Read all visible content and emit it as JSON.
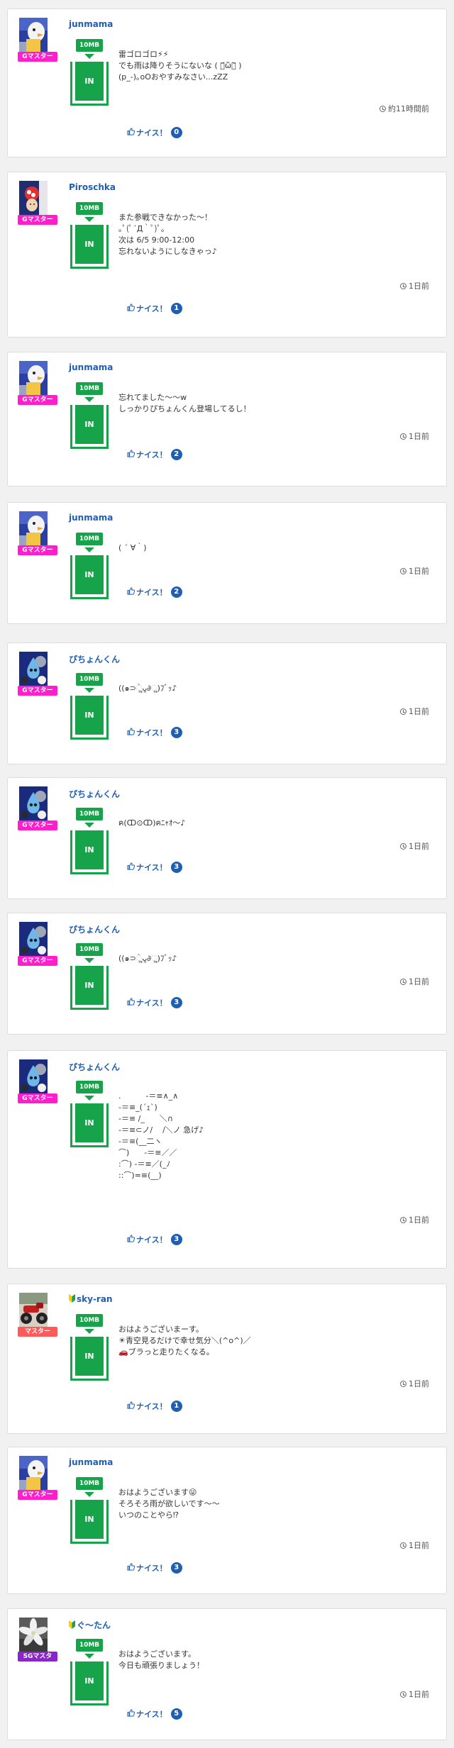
{
  "colors": {
    "username": "#1e5fb4",
    "green": "#16a34a",
    "rank_g_master": "#ff1dce",
    "rank_master": "#ff5a5a",
    "rank_sg_master": "#8a25c9",
    "nice_blue": "#1e5fb4"
  },
  "icons": {
    "time": "clock-icon",
    "nice": "thumbs-up-icon",
    "beginner": "beginner-leaf-icon"
  },
  "posts": [
    {
      "username": "junmama",
      "beginner": false,
      "rank": "Gマスター",
      "size_label": "10MB",
      "status_label": "IN",
      "message": "雷ゴロゴロ⚡⚡\nでも雨は降りそうにないな ( ･᷄ὢ･᷅ )\n(p_-)｡oOおやすみなさい...zZZ",
      "time": "約11時間前",
      "nice_label": "ナイス！",
      "nice_count": "0"
    },
    {
      "username": "Piroschka",
      "beginner": false,
      "rank": "Gマスター",
      "size_label": "10MB",
      "status_label": "IN",
      "message": "また参戦できなかった〜！\n｡ﾟ(ﾟ´Д｀ﾟ)ﾟ｡\n次は 6/5 9:00-12:00\n忘れないようにしなきゃっ♪",
      "time": "1日前",
      "nice_label": "ナイス！",
      "nice_count": "1"
    },
    {
      "username": "junmama",
      "beginner": false,
      "rank": "Gマスター",
      "size_label": "10MB",
      "status_label": "IN",
      "message": "忘れてました〜〜w\nしっかりぴちょんくん登場してるし！",
      "time": "1日前",
      "nice_label": "ナイス！",
      "nice_count": "2"
    },
    {
      "username": "junmama",
      "beginner": false,
      "rank": "Gマスター",
      "size_label": "10MB",
      "status_label": "IN",
      "message": "( ´ ∀｀)",
      "time": "1日前",
      "nice_label": "ナイス！",
      "nice_count": "2"
    },
    {
      "username": "ぴちょんくん",
      "beginner": false,
      "rank": "Gマスター",
      "size_label": "10MB",
      "status_label": "IN",
      "message": "((๑⊃ૢ̀ᴗ͈∂ૢ)ﾌﾞｯ♪",
      "time": "1日前",
      "nice_label": "ナイス！",
      "nice_count": "3"
    },
    {
      "username": "ぴちょんくん",
      "beginner": false,
      "rank": "Gマスター",
      "size_label": "10MB",
      "status_label": "IN",
      "message": "ฅ(ↀ⊙ↀ)ฅﾆｬｵ〜♪",
      "time": "1日前",
      "nice_label": "ナイス！",
      "nice_count": "3"
    },
    {
      "username": "ぴちょんくん",
      "beginner": false,
      "rank": "Gマスター",
      "size_label": "10MB",
      "status_label": "IN",
      "message": "((๑⊃ૢ̀ᴗ͈∂ૢ)ﾌﾞｯ♪",
      "time": "1日前",
      "nice_label": "ナイス！",
      "nice_count": "3"
    },
    {
      "username": "ぴちょんくん",
      "beginner": false,
      "rank": "Gマスター",
      "size_label": "10MB",
      "status_label": "IN",
      "message": ".          -＝≡∧_∧\n-＝≡_(´ｪ`)\n-＝≡ /_      ＼∩\n-＝≡⊂ノ/    /＼ノ 急げ♪\n-＝≡(__二ヽ\n⌒)      -＝≡／／\n:⌒) -＝≡／(_ﾉ\n::⌒)=≡(__)",
      "time": "1日前",
      "nice_label": "ナイス！",
      "nice_count": "3"
    },
    {
      "username": "sky-ran",
      "beginner": true,
      "rank": "マスター",
      "size_label": "10MB",
      "status_label": "IN",
      "message": "おはようございまーす。\n☀青空見るだけで幸せ気分＼(^o^)／\n🚗ブラっと走りたくなる。",
      "time": "1日前",
      "nice_label": "ナイス！",
      "nice_count": "1"
    },
    {
      "username": "junmama",
      "beginner": false,
      "rank": "Gマスター",
      "size_label": "10MB",
      "status_label": "IN",
      "message": "おはようございます😜\nそろそろ雨が欲しいです〜〜\nいつのことやら⁉",
      "time": "1日前",
      "nice_label": "ナイス！",
      "nice_count": "3"
    },
    {
      "username": "ぐ〜たん",
      "beginner": true,
      "rank": "SGマスタ",
      "size_label": "10MB",
      "status_label": "IN",
      "message": "おはようございます。\n今日も頑張りましょう！",
      "time": "1日前",
      "nice_label": "ナイス！",
      "nice_count": "5"
    }
  ]
}
